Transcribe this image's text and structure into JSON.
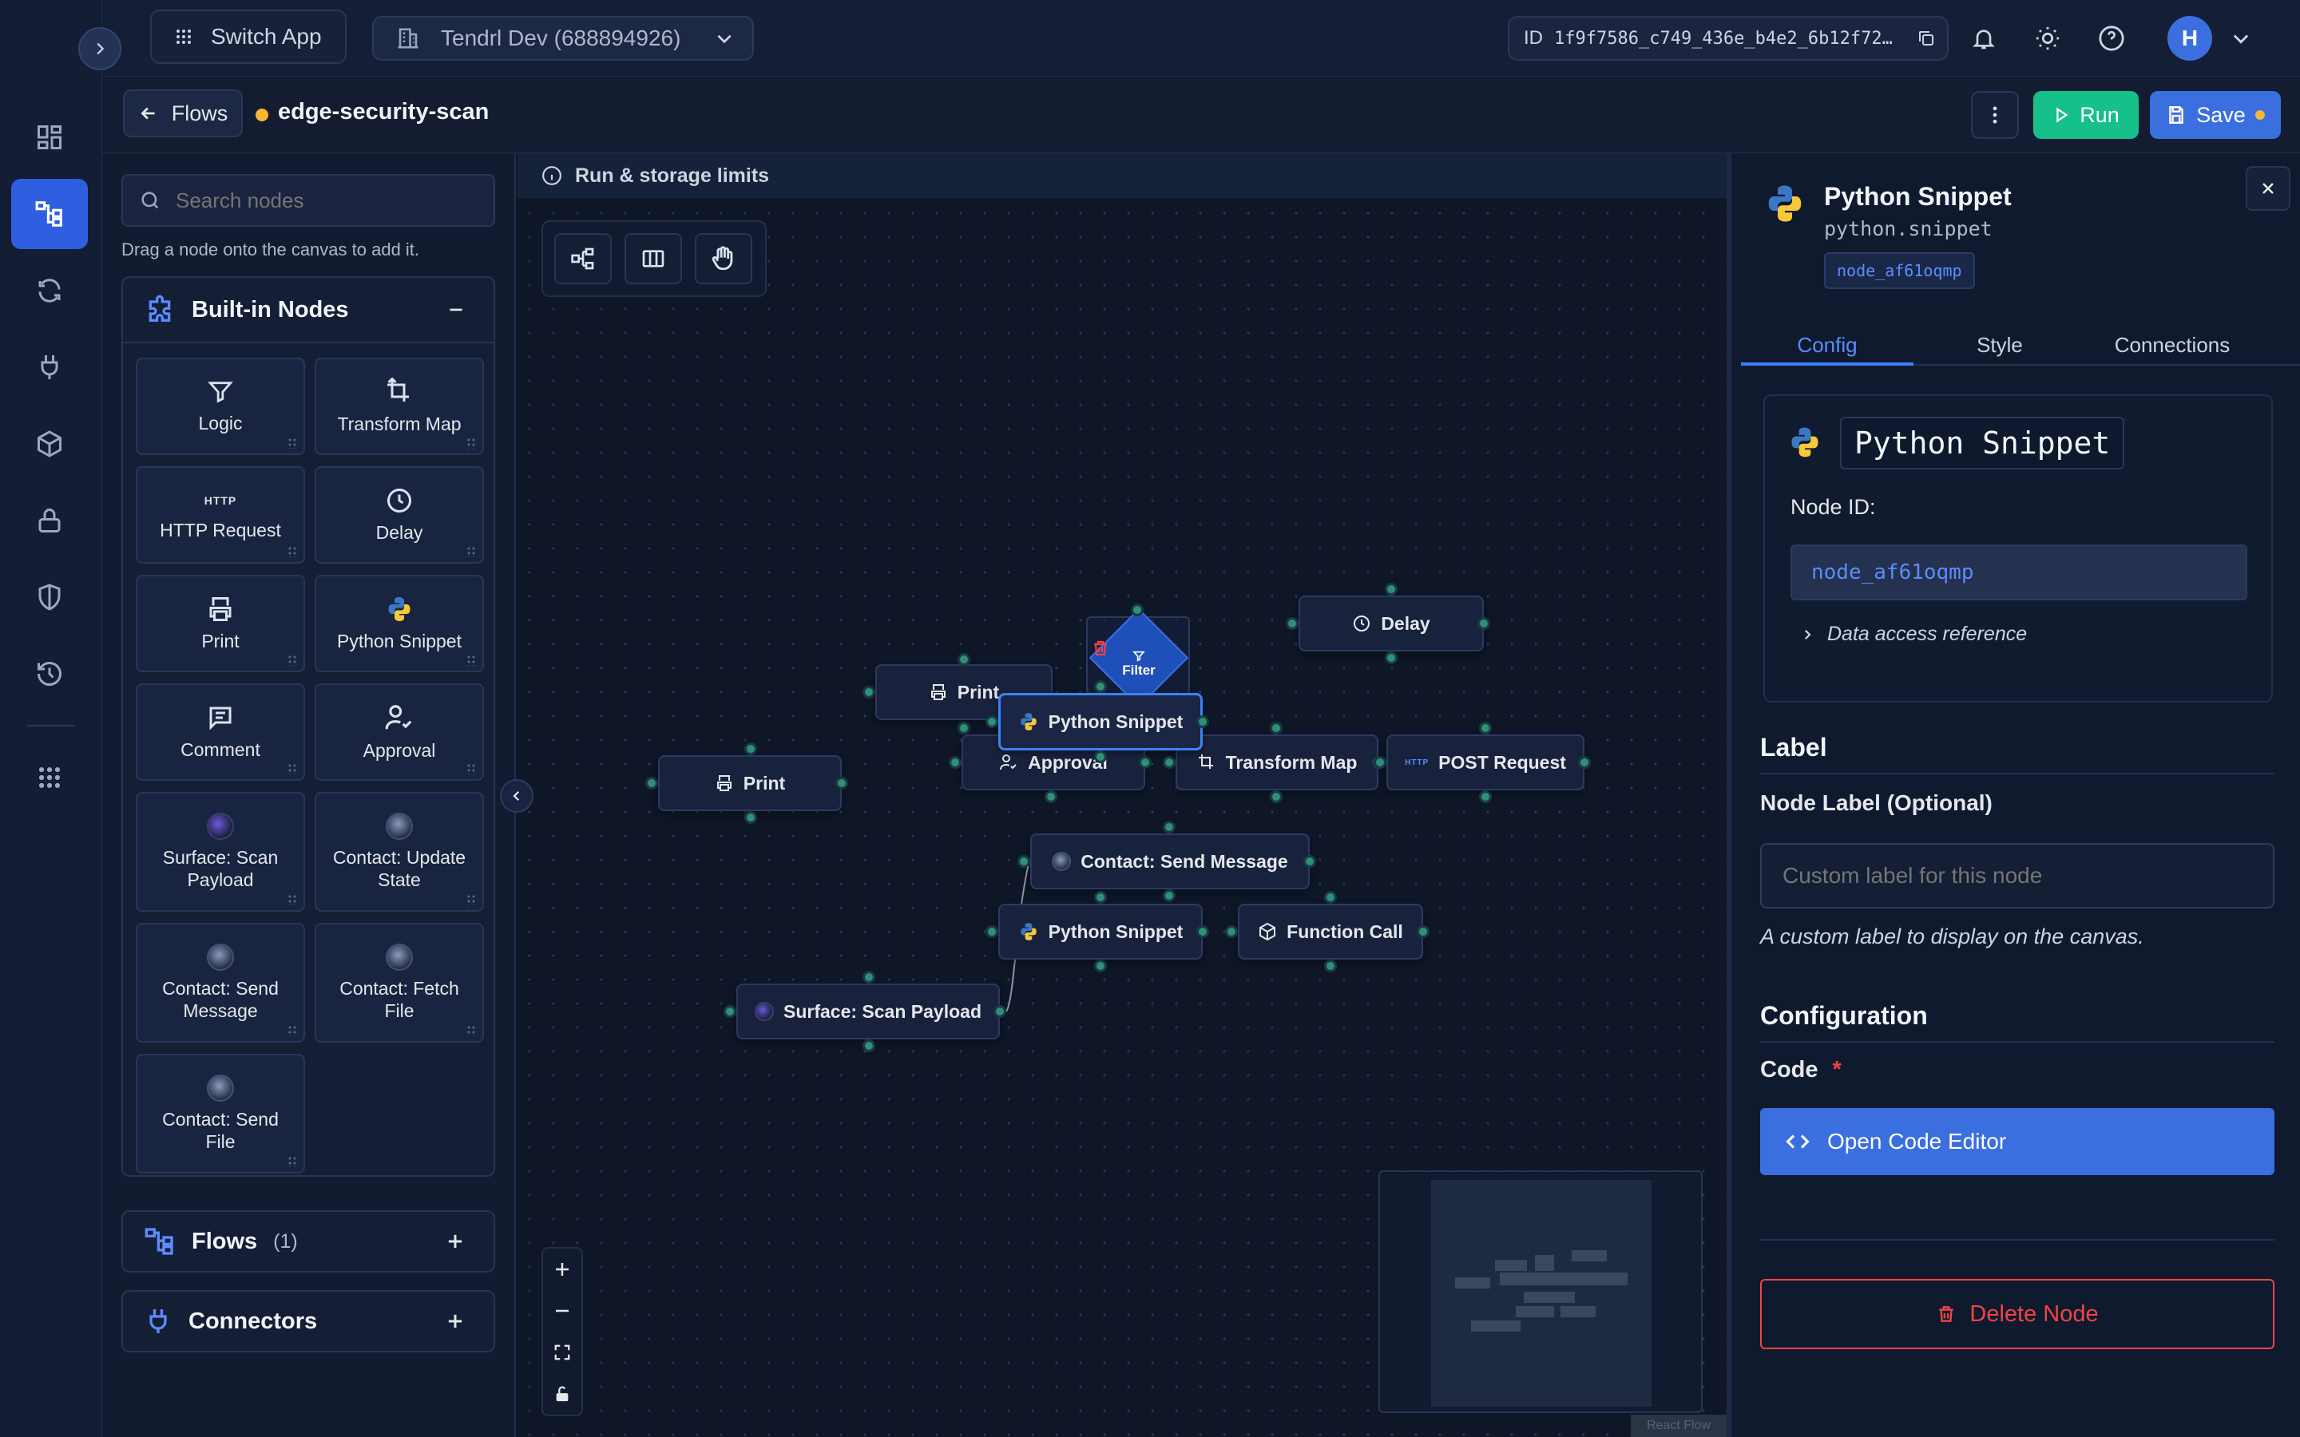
{
  "topbar": {
    "switch_app": "Switch App",
    "workspace": "Tendrl Dev (688894926)",
    "id_prefix": "ID",
    "id_value": "1f9f7586_c749_436e_b4e2_6b12f72…",
    "avatar_initial": "H"
  },
  "breadcrumb": {
    "back_label": "Flows",
    "flow_name": "edge-security-scan",
    "run_label": "Run",
    "save_label": "Save"
  },
  "palette": {
    "search_placeholder": "Search nodes",
    "hint": "Drag a node onto the canvas to add it.",
    "builtin_title": "Built-in Nodes",
    "tiles": [
      {
        "label": "Logic",
        "icon": "filter-icon"
      },
      {
        "label": "Transform Map",
        "icon": "transform-icon"
      },
      {
        "label": "HTTP Request",
        "icon": "http-icon",
        "glyph": "HTTP"
      },
      {
        "label": "Delay",
        "icon": "clock-icon"
      },
      {
        "label": "Print",
        "icon": "printer-icon"
      },
      {
        "label": "Python Snippet",
        "icon": "python-icon"
      },
      {
        "label": "Comment",
        "icon": "comment-icon"
      },
      {
        "label": "Approval",
        "icon": "approval-icon"
      },
      {
        "label": "Surface: Scan Payload",
        "icon": "surface-icon"
      },
      {
        "label": "Contact: Update State",
        "icon": "contact-icon"
      },
      {
        "label": "Contact: Send Message",
        "icon": "contact-icon"
      },
      {
        "label": "Contact: Fetch File",
        "icon": "contact-icon"
      },
      {
        "label": "Contact: Send File",
        "icon": "contact-icon"
      }
    ],
    "flows_title": "Flows",
    "flows_count": "(1)",
    "connectors_title": "Connectors"
  },
  "canvas": {
    "limits_label": "Run & storage limits",
    "nodes": {
      "print_a": "Print",
      "print_b": "Print",
      "filter": "Filter",
      "python_a": "Python Snippet",
      "approval": "Approval",
      "transform": "Transform Map",
      "post": "POST Request",
      "post_glyph": "HTTP",
      "delay": "Delay",
      "contact_send": "Contact: Send Message",
      "python_b": "Python Snippet",
      "function_call": "Function Call",
      "surface": "Surface: Scan Payload"
    },
    "attribution": "React Flow"
  },
  "panel": {
    "title": "Python Snippet",
    "type": "python.snippet",
    "node_id_badge": "node_af61oqmp",
    "tabs": [
      "Config",
      "Style",
      "Connections"
    ],
    "card_title": "Python Snippet",
    "node_id_label": "Node ID:",
    "node_id_value": "node_af61oqmp",
    "data_ref": "Data access reference",
    "label_section": "Label",
    "node_label": "Node Label (Optional)",
    "node_label_placeholder": "Custom label for this node",
    "node_label_help": "A custom label to display on the canvas.",
    "config_section": "Configuration",
    "code_label": "Code",
    "required_mark": "*",
    "open_code_editor": "Open Code Editor",
    "delete_node": "Delete Node"
  },
  "colors": {
    "accent": "#3b6fe0",
    "run": "#16c08a",
    "danger": "#ef4444",
    "unsaved_dot": "#f5b82e"
  }
}
